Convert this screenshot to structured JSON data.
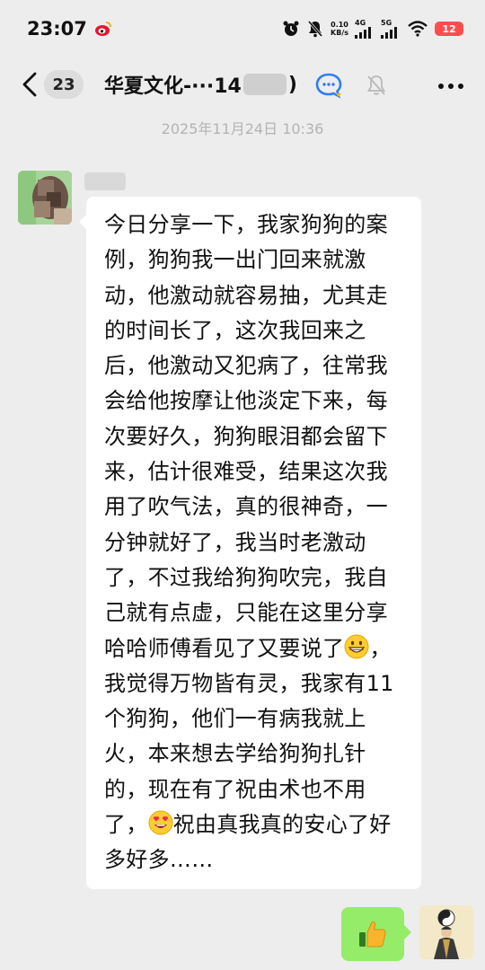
{
  "status_bar": {
    "time": "23:07",
    "net_speed_value": "0.10",
    "net_speed_unit": "KB/s",
    "signal_1": "4G",
    "signal_2": "5G",
    "battery": "12",
    "icons": [
      "weibo-icon",
      "alarm-icon",
      "mute-icon",
      "signal-icon",
      "wifi-icon",
      "battery-icon"
    ]
  },
  "header": {
    "unread_count": "23",
    "title_prefix": "华夏文化-···14",
    "title_suffix": ")",
    "icons": [
      "back-icon",
      "qa-icon",
      "bell-icon",
      "more-icon"
    ]
  },
  "chat": {
    "timestamp": "2025年11月24日 10:36",
    "incoming": {
      "text_part1": "今日分享一下，我家狗狗的案例，狗狗我一出门回来就激动，他激动就容易抽，尤其走的时间长了，这次我回来之后，他激动又犯病了，往常我会给他按摩让他淡定下来，每次要好久，狗狗眼泪都会留下来，估计很难受，结果这次我用了吹气法，真的很神奇，一分钟就好了，我当时老激动了，不过我给狗狗吹完，我自己就有点虚，只能在这里分享哈哈师傅看见了又要说了",
      "emoji_1": "grinning-face",
      "text_part2": "，我觉得万物皆有灵，我家有11个狗狗，他们一有病我就上火，本来想去学给狗狗扎针的，现在有了祝由术也不用了，",
      "emoji_2": "heart-eyes-face",
      "text_part3": "祝由真我真的安心了好多好多……"
    },
    "outgoing": {
      "content": "thumbs-up-icon"
    }
  },
  "colors": {
    "background": "#ededed",
    "bubble_in": "#ffffff",
    "bubble_out": "#95ec69",
    "battery": "#ff4d4f",
    "timestamp": "#b3b3b3"
  }
}
